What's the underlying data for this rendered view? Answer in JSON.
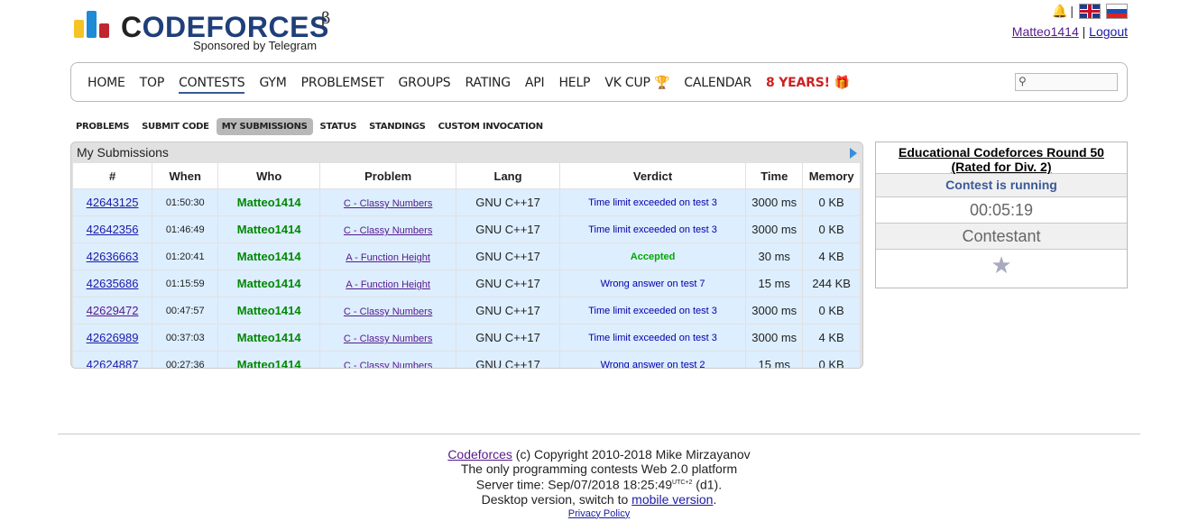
{
  "header": {
    "logo_text_cf": "C",
    "logo_text_rest": "ODEFORCES",
    "beta": "β",
    "sponsor": "Sponsored by Telegram",
    "username": "Matteo1414",
    "divider": "|",
    "logout": "Logout"
  },
  "menu": {
    "items": [
      "HOME",
      "TOP",
      "CONTESTS",
      "GYM",
      "PROBLEMSET",
      "GROUPS",
      "RATING",
      "API",
      "HELP",
      "VK CUP",
      "CALENDAR",
      "8 YEARS!"
    ],
    "active": "CONTESTS",
    "search_placeholder": ""
  },
  "subtabs": [
    "PROBLEMS",
    "SUBMIT CODE",
    "MY SUBMISSIONS",
    "STATUS",
    "STANDINGS",
    "CUSTOM INVOCATION"
  ],
  "submissions": {
    "title": "My Submissions",
    "columns": [
      "#",
      "When",
      "Who",
      "Problem",
      "Lang",
      "Verdict",
      "Time",
      "Memory"
    ],
    "rows": [
      {
        "id": "42643125",
        "when": "01:50:30",
        "who": "Matteo1414",
        "problem": "C - Classy Numbers",
        "lang": "GNU C++17",
        "verdict": "Time limit exceeded on test 3",
        "time": "3000 ms",
        "memory": "0 KB"
      },
      {
        "id": "42642356",
        "when": "01:46:49",
        "who": "Matteo1414",
        "problem": "C - Classy Numbers",
        "lang": "GNU C++17",
        "verdict": "Time limit exceeded on test 3",
        "time": "3000 ms",
        "memory": "0 KB"
      },
      {
        "id": "42636663",
        "when": "01:20:41",
        "who": "Matteo1414",
        "problem": "A - Function Height",
        "lang": "GNU C++17",
        "verdict": "Accepted",
        "time": "30 ms",
        "memory": "4 KB"
      },
      {
        "id": "42635686",
        "when": "01:15:59",
        "who": "Matteo1414",
        "problem": "A - Function Height",
        "lang": "GNU C++17",
        "verdict": "Wrong answer on test 7",
        "time": "15 ms",
        "memory": "244 KB"
      },
      {
        "id": "42629472",
        "when": "00:47:57",
        "who": "Matteo1414",
        "problem": "C - Classy Numbers",
        "lang": "GNU C++17",
        "verdict": "Time limit exceeded on test 3",
        "time": "3000 ms",
        "memory": "0 KB"
      },
      {
        "id": "42626989",
        "when": "00:37:03",
        "who": "Matteo1414",
        "problem": "C - Classy Numbers",
        "lang": "GNU C++17",
        "verdict": "Time limit exceeded on test 3",
        "time": "3000 ms",
        "memory": "4 KB"
      },
      {
        "id": "42624887",
        "when": "00:27:36",
        "who": "Matteo1414",
        "problem": "C - Classy Numbers",
        "lang": "GNU C++17",
        "verdict": "Wrong answer on test 2",
        "time": "15 ms",
        "memory": "0 KB"
      }
    ]
  },
  "sidebar": {
    "contest_name": "Educational Codeforces Round 50 (Rated for Div. 2)",
    "status": "Contest is running",
    "timer": "00:05:19",
    "role": "Contestant"
  },
  "footer": {
    "site_link": "Codeforces",
    "copyright": " (c) Copyright 2010-2018 Mike Mirzayanov",
    "tagline": "The only programming contests Web 2.0 platform",
    "server_time_prefix": "Server time: Sep/07/2018 18:25:49",
    "utc": "UTC+2",
    "server_time_suffix": " (d1).",
    "desktop_prefix": "Desktop version, switch to ",
    "mobile_link": "mobile version",
    "desktop_suffix": ".",
    "privacy": "Privacy Policy"
  },
  "colors": {
    "accent": "#3b5998",
    "accepted": "#00a900",
    "verdict_default": "#0000aa",
    "user_green": "#008800",
    "row_highlight": "#ddeeff",
    "special_menu": "#cc2222"
  },
  "icons": [
    "bell-icon",
    "uk-flag-icon",
    "ru-flag-icon",
    "trophy-icon",
    "gift-icon",
    "search-icon",
    "arrow-right-icon",
    "star-icon"
  ]
}
